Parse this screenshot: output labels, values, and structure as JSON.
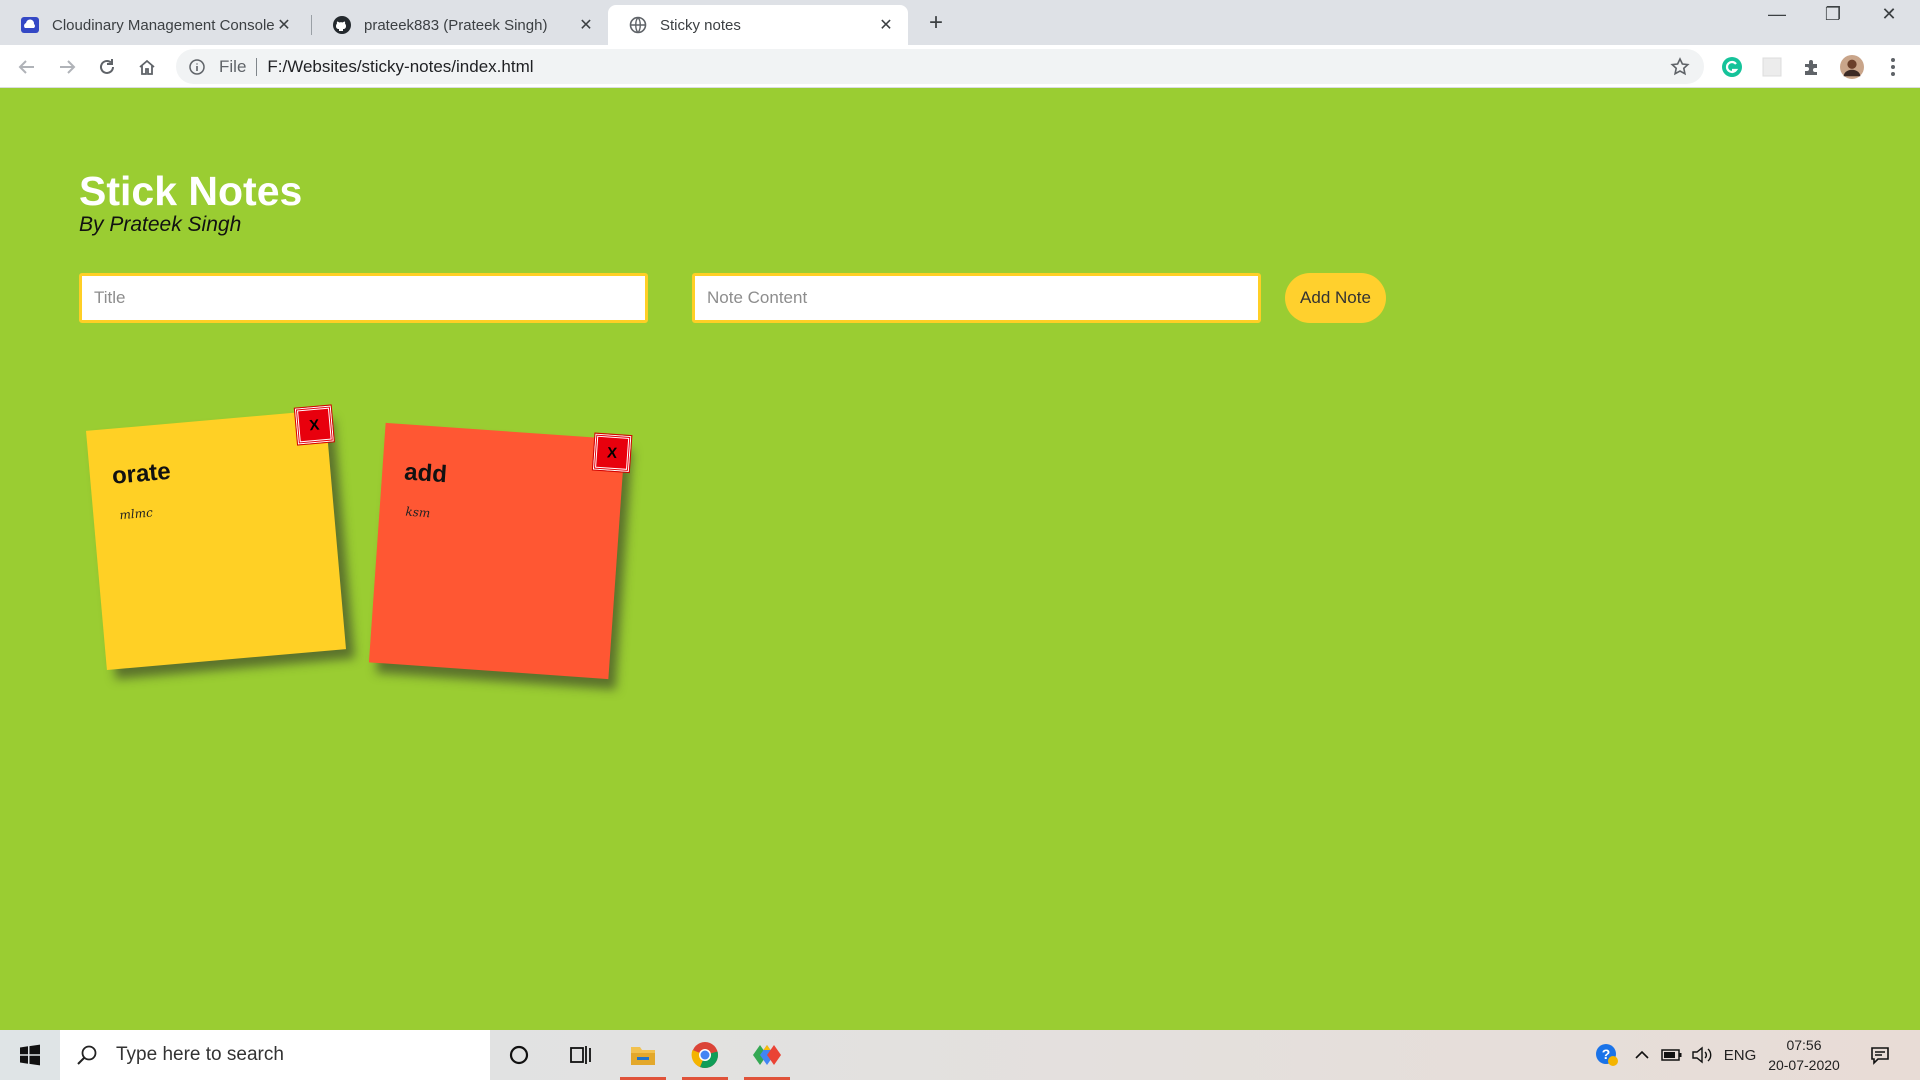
{
  "browser": {
    "tabs": [
      {
        "title": "Cloudinary Management Console",
        "icon": "cloudinary-icon",
        "active": false
      },
      {
        "title": "prateek883 (Prateek Singh)",
        "icon": "github-icon",
        "active": false
      },
      {
        "title": "Sticky notes",
        "icon": "globe-icon",
        "active": true
      }
    ],
    "close_glyph": "✕",
    "new_tab_glyph": "+",
    "window_controls": {
      "minimize": "—",
      "restore": "❐",
      "close": "✕"
    },
    "address": {
      "scheme": "File",
      "url": "F:/Websites/sticky-notes/index.html"
    }
  },
  "page": {
    "title": "Stick Notes",
    "subtitle": "By Prateek Singh",
    "form": {
      "title_placeholder": "Title",
      "content_placeholder": "Note Content",
      "add_label": "Add Note"
    },
    "notes": [
      {
        "title": "orate",
        "content": "mlmc",
        "color": "#ffd025",
        "rotation_deg": -5
      },
      {
        "title": "add",
        "content": "ksm",
        "color": "#ff5733",
        "rotation_deg": 4
      }
    ],
    "close_label": "X"
  },
  "taskbar": {
    "search_placeholder": "Type here to search",
    "language": "ENG",
    "time": "07:56",
    "date": "20-07-2020"
  },
  "colors": {
    "page_background": "#9acd32",
    "accent_yellow": "#ffd02d",
    "close_red": "#e8000d"
  }
}
